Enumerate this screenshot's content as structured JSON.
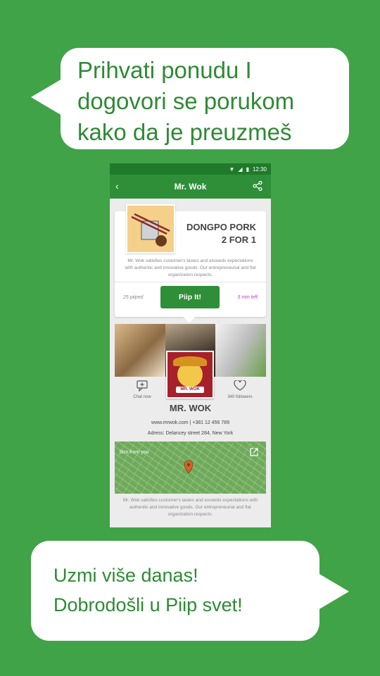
{
  "promo": {
    "top_text": "Prihvati ponudu I\ndogovori se porukom\nkako da je preuzmeš",
    "bottom_text": "Uzmi više danas!\nDobrodošli u Piip svet!"
  },
  "status_bar": {
    "time": "12:30"
  },
  "app_bar": {
    "title": "Mr. Wok"
  },
  "offer_card": {
    "offer_title": "DONGPO PORK\n2 FOR 1",
    "description": "Mr. Wok satisfies customer's tastes and exceeds expectations with authentic and innovative goods. Our entrepreneurial and flat organization respects.",
    "piiped_count": "25 piiped",
    "button_label": "Piip It!",
    "time_left": "5 min left"
  },
  "business": {
    "logo_text": "MR. WOK",
    "chat_label": "Chat now",
    "followers_label": "340 followers",
    "name": "MR. WOK",
    "contact": "www.mrwok.com   |   +381 12 456 789",
    "address": "Adress: Delancey street 284, New York",
    "map_distance": "1km from you",
    "description": "Mr. Wok satisfies customer's tastes and exceeds expectations with authentic and innovative goods. Our entrepreneurial and flat organization respects."
  },
  "colors": {
    "background": "#40a347",
    "brand_green": "#2e8f38",
    "time_left_accent": "#c23ebf"
  },
  "icons": [
    "wifi-icon",
    "signal-icon",
    "battery-icon",
    "back-icon",
    "share-icon",
    "chat-icon",
    "heart-icon",
    "map-pin-icon",
    "external-link-icon"
  ]
}
